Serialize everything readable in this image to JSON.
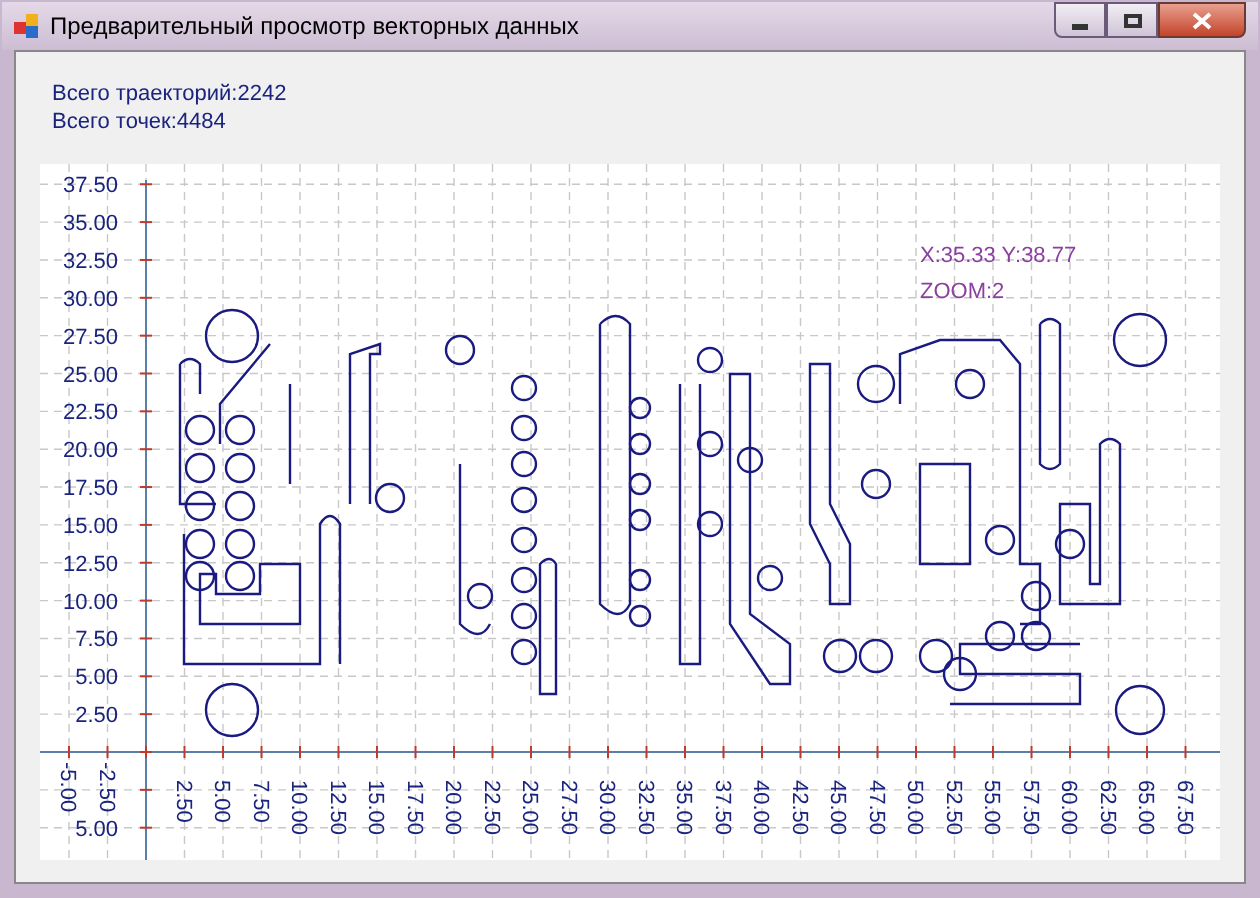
{
  "window": {
    "title": "Предварительный просмотр векторных данных"
  },
  "stats": [
    "Всего траекторий:2242",
    "Всего точек:4484"
  ],
  "plot": {
    "cursor_readout": "X:35.33 Y:38.77",
    "zoom_readout": "ZOOM:2",
    "y_tick_labels": [
      "37.50",
      "35.00",
      "32.50",
      "30.00",
      "27.50",
      "25.00",
      "22.50",
      "20.00",
      "17.50",
      "15.00",
      "12.50",
      "10.00",
      "7.50",
      "5.00",
      "2.50"
    ],
    "y_tick_labels_below_axis": [
      "5.00"
    ],
    "x_tick_labels_negative": [
      "-5.00",
      "-2.50"
    ],
    "x_tick_labels": [
      "2.50",
      "5.00",
      "7.50",
      "10.00",
      "12.50",
      "15.00",
      "17.50",
      "20.00",
      "22.50",
      "25.00",
      "27.50",
      "30.00",
      "32.50",
      "35.00",
      "37.50",
      "40.00",
      "42.50",
      "45.00",
      "47.50",
      "50.00",
      "52.50",
      "55.00",
      "57.50",
      "60.00",
      "62.50",
      "65.00",
      "67.50"
    ]
  }
}
